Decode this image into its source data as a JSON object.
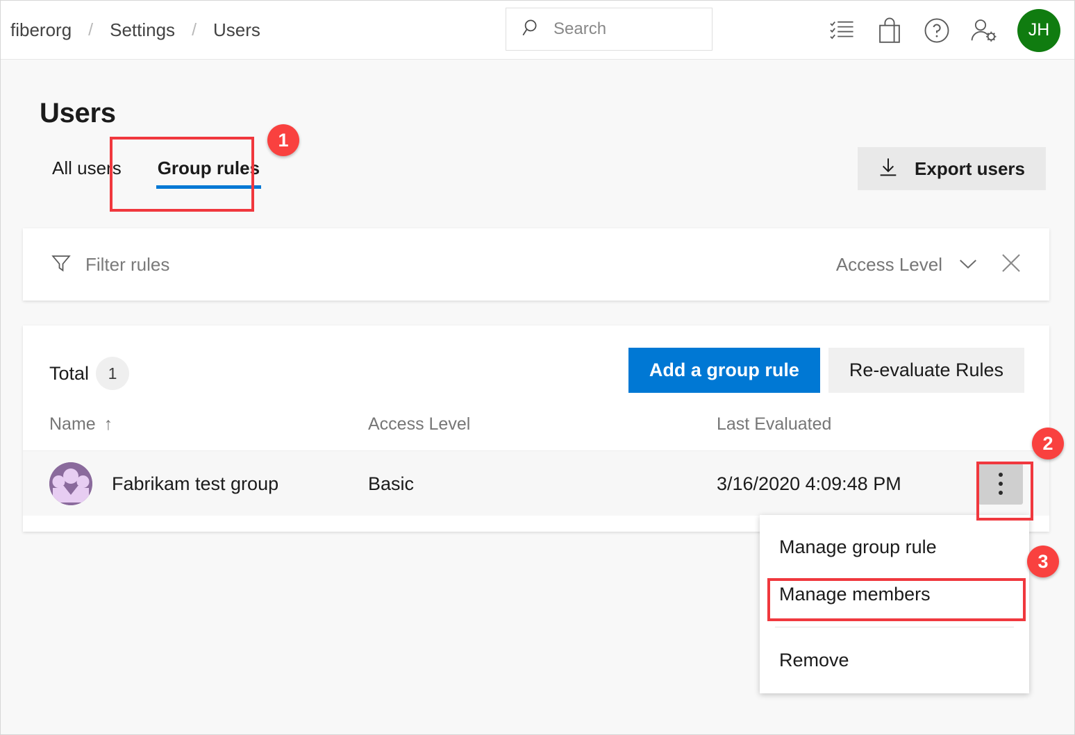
{
  "topbar": {
    "breadcrumb": [
      "fiberorg",
      "Settings",
      "Users"
    ],
    "separator": "/",
    "search": {
      "placeholder": "Search",
      "value": "",
      "icon": "search-icon"
    },
    "icons": [
      {
        "name": "task-list-icon",
        "label": "Work items"
      },
      {
        "name": "marketplace-bag-icon",
        "label": "Marketplace"
      },
      {
        "name": "help-question-icon",
        "label": "Help"
      },
      {
        "name": "user-settings-icon",
        "label": "User settings"
      }
    ],
    "avatar": {
      "initials": "JH",
      "color": "#107c10"
    }
  },
  "page": {
    "title": "Users",
    "tabs": [
      {
        "label": "All users",
        "active": false
      },
      {
        "label": "Group rules",
        "active": true
      }
    ],
    "export_button": {
      "label": "Export users",
      "icon": "download-icon"
    }
  },
  "filter": {
    "icon": "filter-funnel-icon",
    "placeholder": "Filter rules",
    "value": "",
    "access_level": {
      "label": "Access Level",
      "chevron": "chevron-down-icon"
    },
    "clear": {
      "icon": "close-icon"
    }
  },
  "table": {
    "total_label": "Total",
    "total_count": "1",
    "primary_button": "Add a group rule",
    "secondary_button": "Re-evaluate Rules",
    "columns": [
      {
        "key": "name",
        "label": "Name",
        "sort": "↑"
      },
      {
        "key": "level",
        "label": "Access Level",
        "sort": ""
      },
      {
        "key": "eval",
        "label": "Last Evaluated",
        "sort": ""
      }
    ],
    "rows": [
      {
        "avatar": "group-avatar-icon",
        "name": "Fabrikam test group",
        "level": "Basic",
        "evaluated": "3/16/2020 4:09:48 PM",
        "menu": "more-actions-icon"
      }
    ]
  },
  "context_menu": {
    "items": [
      {
        "label": "Manage group rule",
        "highlighted": false
      },
      {
        "label": "Manage members",
        "highlighted": true
      },
      {
        "label": "Remove",
        "highlighted": false
      }
    ]
  },
  "annotations": {
    "badges": [
      {
        "number": "1",
        "target": "group-rules-tab"
      },
      {
        "number": "2",
        "target": "row-more-actions-button"
      },
      {
        "number": "3",
        "target": "manage-members-menu-item"
      }
    ],
    "highlight_color": "#f0383e"
  },
  "colors": {
    "accent": "#0078d4",
    "avatar_green": "#107c10",
    "group_avatar_purple": "#8a6a9c",
    "group_avatar_light": "#e7cdf2",
    "page_background": "#f8f8f8",
    "annotation_red": "#f9413f"
  }
}
